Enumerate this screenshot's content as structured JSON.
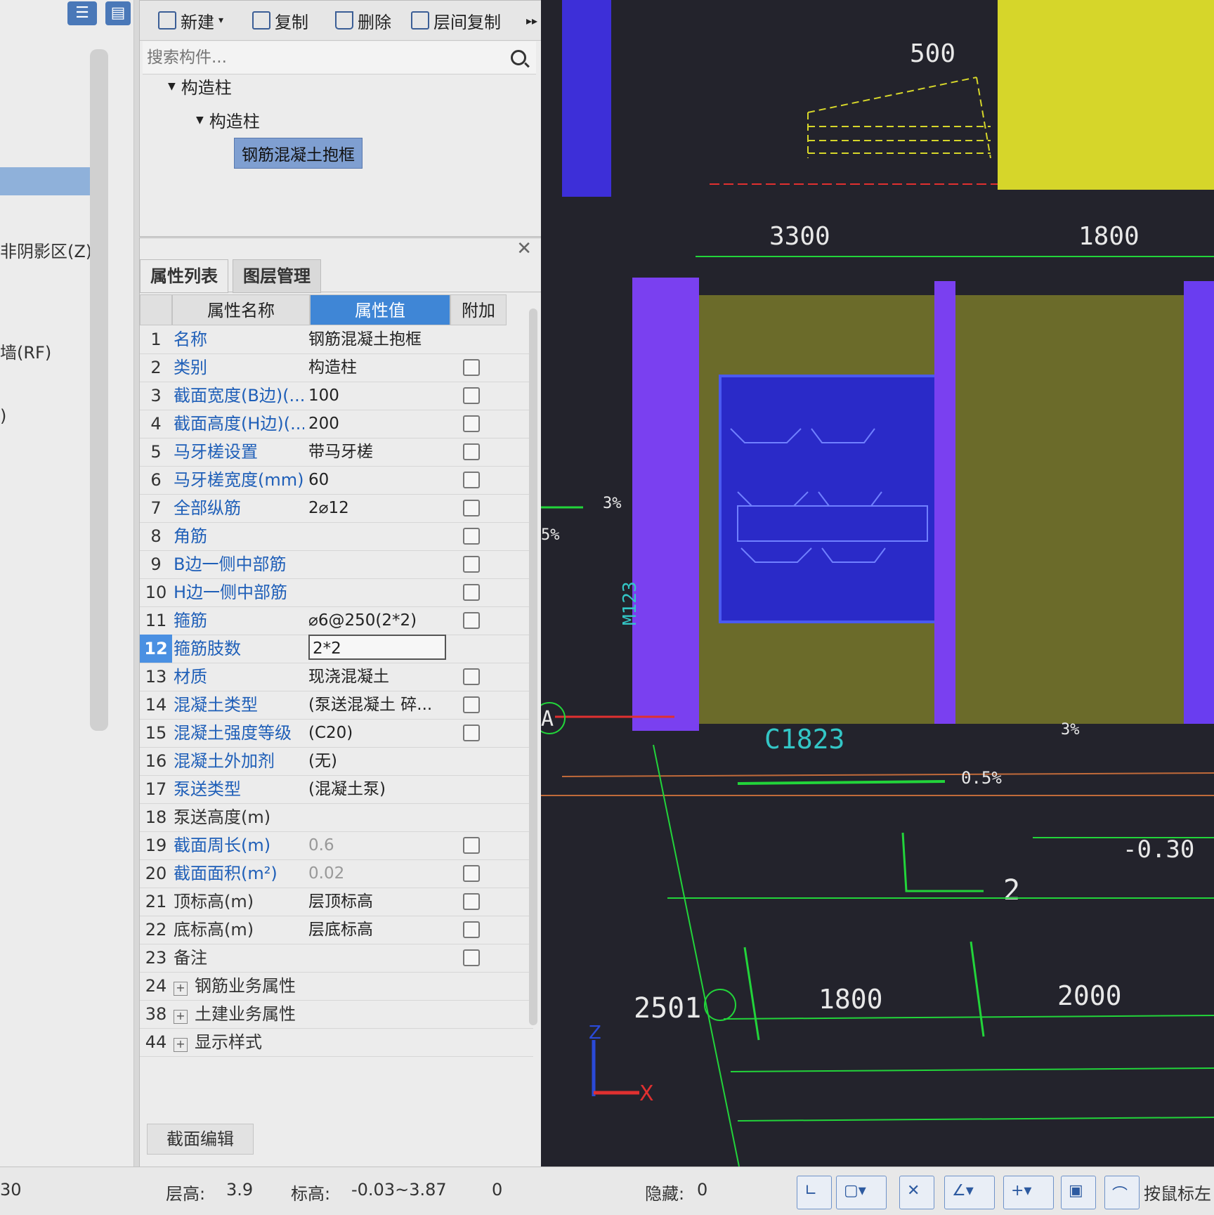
{
  "left_tree": {
    "items": [
      "非阴影区(Z)",
      "墙(RF)",
      ")"
    ],
    "bottom_value": "30"
  },
  "toolbar": {
    "new_label": "新建",
    "copy_label": "复制",
    "delete_label": "删除",
    "floor_copy_label": "层间复制",
    "more_label": "▸▸"
  },
  "search": {
    "placeholder": "搜索构件..."
  },
  "component_tree": {
    "group": "构造柱",
    "subgroup": "构造柱",
    "selected_item": "钢筋混凝土抱框"
  },
  "property_panel": {
    "tabs": [
      "属性列表",
      "图层管理"
    ],
    "columns": [
      "属性名称",
      "属性值",
      "附加"
    ],
    "selected_row": "12",
    "rows": [
      {
        "num": "1",
        "name": "名称",
        "value": "钢筋混凝土抱框",
        "cb": false
      },
      {
        "num": "2",
        "name": "类别",
        "value": "构造柱",
        "cb": true
      },
      {
        "num": "3",
        "name": "截面宽度(B边)(...",
        "value": "100",
        "cb": true
      },
      {
        "num": "4",
        "name": "截面高度(H边)(...",
        "value": "200",
        "cb": true
      },
      {
        "num": "5",
        "name": "马牙槎设置",
        "value": "带马牙槎",
        "cb": true
      },
      {
        "num": "6",
        "name": "马牙槎宽度(mm)",
        "value": "60",
        "cb": true
      },
      {
        "num": "7",
        "name": "全部纵筋",
        "value": "2⌀12",
        "cb": true
      },
      {
        "num": "8",
        "name": "角筋",
        "value": "",
        "cb": true
      },
      {
        "num": "9",
        "name": "B边一侧中部筋",
        "value": "",
        "cb": true
      },
      {
        "num": "10",
        "name": "H边一侧中部筋",
        "value": "",
        "cb": true
      },
      {
        "num": "11",
        "name": "箍筋",
        "value": "⌀6@250(2*2)",
        "cb": true
      },
      {
        "num": "12",
        "name": "箍筋肢数",
        "value": "2*2",
        "cb": false
      },
      {
        "num": "13",
        "name": "材质",
        "value": "现浇混凝土",
        "cb": true
      },
      {
        "num": "14",
        "name": "混凝土类型",
        "value": "(泵送混凝土 碎...",
        "cb": true
      },
      {
        "num": "15",
        "name": "混凝土强度等级",
        "value": "(C20)",
        "cb": true
      },
      {
        "num": "16",
        "name": "混凝土外加剂",
        "value": "(无)",
        "cb": false
      },
      {
        "num": "17",
        "name": "泵送类型",
        "value": "(混凝土泵)",
        "cb": false
      },
      {
        "num": "18",
        "name": "泵送高度(m)",
        "value": "",
        "cb": false
      },
      {
        "num": "19",
        "name": "截面周长(m)",
        "value": "0.6",
        "cb": true
      },
      {
        "num": "20",
        "name": "截面面积(m²)",
        "value": "0.02",
        "cb": true
      },
      {
        "num": "21",
        "name": "顶标高(m)",
        "value": "层顶标高",
        "cb": true
      },
      {
        "num": "22",
        "name": "底标高(m)",
        "value": "层底标高",
        "cb": true
      },
      {
        "num": "23",
        "name": "备注",
        "value": "",
        "cb": true
      },
      {
        "num": "24",
        "name": "钢筋业务属性",
        "value": "",
        "cb": false
      },
      {
        "num": "38",
        "name": "土建业务属性",
        "value": "",
        "cb": false
      },
      {
        "num": "44",
        "name": "显示样式",
        "value": "",
        "cb": false
      }
    ],
    "section_edit_label": "截面编辑"
  },
  "cad": {
    "dims": [
      "500",
      "3300",
      "1800",
      "2501",
      "1800",
      "2000"
    ],
    "labels": [
      "3%",
      "5%",
      "C1823",
      "3%",
      "0.5%",
      "-0.30",
      "2",
      "A",
      "Z",
      "X",
      "M123"
    ],
    "colors": {
      "background": "#23232c",
      "wall": "#6a3df0",
      "floor": "#6b6b2a",
      "yellow": "#d6d62a",
      "green": "#22d43a",
      "cyan": "#33c6c6"
    }
  },
  "status_bar": {
    "floor_height_label": "层高:",
    "floor_height_value": "3.9",
    "elevation_label": "标高:",
    "elevation_value": "-0.03~3.87",
    "zero": "0",
    "hidden_label": "隐藏:",
    "hidden_value": "0",
    "right_text": "按鼠标左"
  }
}
